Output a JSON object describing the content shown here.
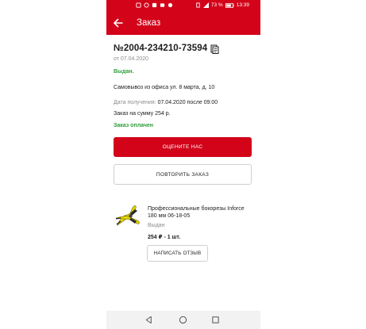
{
  "status_bar": {
    "battery_percent": "73 %",
    "time": "13:39"
  },
  "app_bar": {
    "title": "Заказ",
    "back_icon": "arrow-left-icon"
  },
  "order": {
    "number": "№2004-234210-73594",
    "date": "от 07.04.2020",
    "status": "Выдан.",
    "pickup": "Самовывоз из офиса ул. 8 марта, д. 10",
    "receive_label": "Дата получения:",
    "receive_value": "07.04.2020 после 09:00",
    "sum": "Заказ на сумму 254 р.",
    "paid": "Заказ оплачен"
  },
  "buttons": {
    "rate": "ОЦЕНИТЕ НАС",
    "repeat": "ПОВТОРИТЬ ЗАКАЗ",
    "review": "НАПИСАТЬ ОТЗЫВ"
  },
  "product": {
    "name": "Профессиональные бокорезы Inforce 180 мм 06-18-05",
    "status": "Выдан",
    "price": "254 ₽ - 1 шт."
  },
  "colors": {
    "brand_red": "#d3041a",
    "status_green": "#2e9e3a",
    "muted_gray": "#8d8d8d"
  },
  "nav_icons": [
    "back-triangle-icon",
    "home-circle-icon",
    "recents-square-icon"
  ]
}
